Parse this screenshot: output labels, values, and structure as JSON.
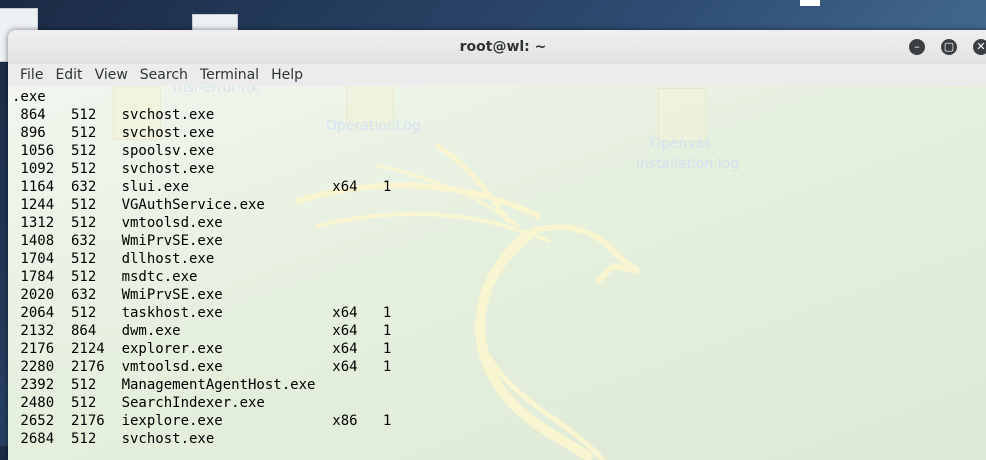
{
  "window": {
    "title": "root@wl: ~",
    "min_glyph": "–",
    "max_glyph": "▢",
    "close_glyph": "✕"
  },
  "menu": [
    "File",
    "Edit",
    "View",
    "Search",
    "Terminal",
    "Help"
  ],
  "desktop_ghost_labels": {
    "msf": "msf-error-fix",
    "oplog": "OperationLog",
    "openvas1": "Openvas-",
    "openvas2": "installation.log"
  },
  "terminal": {
    "first_line": ".exe",
    "processes": [
      {
        "pid": "864",
        "ppid": "512",
        "name": "svchost.exe",
        "arch": "",
        "session": ""
      },
      {
        "pid": "896",
        "ppid": "512",
        "name": "svchost.exe",
        "arch": "",
        "session": ""
      },
      {
        "pid": "1056",
        "ppid": "512",
        "name": "spoolsv.exe",
        "arch": "",
        "session": ""
      },
      {
        "pid": "1092",
        "ppid": "512",
        "name": "svchost.exe",
        "arch": "",
        "session": ""
      },
      {
        "pid": "1164",
        "ppid": "632",
        "name": "slui.exe",
        "arch": "x64",
        "session": "1"
      },
      {
        "pid": "1244",
        "ppid": "512",
        "name": "VGAuthService.exe",
        "arch": "",
        "session": ""
      },
      {
        "pid": "1312",
        "ppid": "512",
        "name": "vmtoolsd.exe",
        "arch": "",
        "session": ""
      },
      {
        "pid": "1408",
        "ppid": "632",
        "name": "WmiPrvSE.exe",
        "arch": "",
        "session": ""
      },
      {
        "pid": "1704",
        "ppid": "512",
        "name": "dllhost.exe",
        "arch": "",
        "session": ""
      },
      {
        "pid": "1784",
        "ppid": "512",
        "name": "msdtc.exe",
        "arch": "",
        "session": ""
      },
      {
        "pid": "2020",
        "ppid": "632",
        "name": "WmiPrvSE.exe",
        "arch": "",
        "session": ""
      },
      {
        "pid": "2064",
        "ppid": "512",
        "name": "taskhost.exe",
        "arch": "x64",
        "session": "1"
      },
      {
        "pid": "2132",
        "ppid": "864",
        "name": "dwm.exe",
        "arch": "x64",
        "session": "1"
      },
      {
        "pid": "2176",
        "ppid": "2124",
        "name": "explorer.exe",
        "arch": "x64",
        "session": "1"
      },
      {
        "pid": "2280",
        "ppid": "2176",
        "name": "vmtoolsd.exe",
        "arch": "x64",
        "session": "1"
      },
      {
        "pid": "2392",
        "ppid": "512",
        "name": "ManagementAgentHost.exe",
        "arch": "",
        "session": ""
      },
      {
        "pid": "2480",
        "ppid": "512",
        "name": "SearchIndexer.exe",
        "arch": "",
        "session": ""
      },
      {
        "pid": "2652",
        "ppid": "2176",
        "name": "iexplore.exe",
        "arch": "x86",
        "session": "1"
      },
      {
        "pid": "2684",
        "ppid": "512",
        "name": "svchost.exe",
        "arch": "",
        "session": ""
      }
    ]
  }
}
